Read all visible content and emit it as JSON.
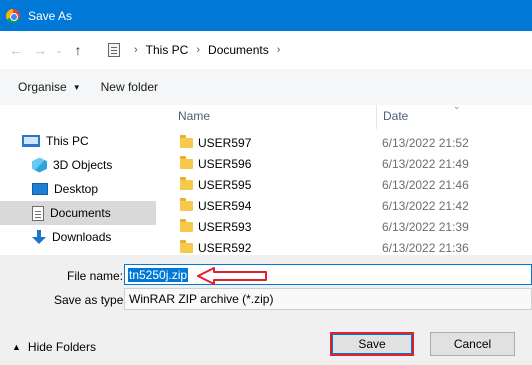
{
  "window": {
    "title": "Save As",
    "app_icon": "chrome-icon"
  },
  "nav": {
    "back_icon": "arrow-left-icon",
    "forward_icon": "arrow-right-icon",
    "recent_icon": "chevron-down-icon",
    "up_icon": "arrow-up-icon",
    "path": [
      "This PC",
      "Documents"
    ]
  },
  "toolbar": {
    "organise_label": "Organise",
    "new_folder_label": "New folder"
  },
  "sidebar": {
    "items": [
      {
        "label": "This PC",
        "icon": "computer-icon"
      },
      {
        "label": "3D Objects",
        "icon": "cube-icon"
      },
      {
        "label": "Desktop",
        "icon": "desktop-icon"
      },
      {
        "label": "Documents",
        "icon": "documents-icon",
        "selected": true
      },
      {
        "label": "Downloads",
        "icon": "download-icon"
      }
    ]
  },
  "files": {
    "columns": [
      "Name",
      "Date"
    ],
    "rows": [
      {
        "name": "USER597",
        "date": "6/13/2022 21:52"
      },
      {
        "name": "USER596",
        "date": "6/13/2022 21:49"
      },
      {
        "name": "USER595",
        "date": "6/13/2022 21:46"
      },
      {
        "name": "USER594",
        "date": "6/13/2022 21:42"
      },
      {
        "name": "USER593",
        "date": "6/13/2022 21:39"
      },
      {
        "name": "USER592",
        "date": "6/13/2022 21:36"
      }
    ]
  },
  "save_form": {
    "file_name_label": "File name:",
    "file_name_value": "tn5250j.zip",
    "save_type_label": "Save as type:",
    "save_type_value": "WinRAR ZIP archive (*.zip)"
  },
  "footer": {
    "hide_folders_label": "Hide Folders",
    "save_label": "Save",
    "cancel_label": "Cancel"
  },
  "colors": {
    "titlebar": "#0078d7",
    "highlight": "#e0202b",
    "selection": "#0078d7"
  }
}
